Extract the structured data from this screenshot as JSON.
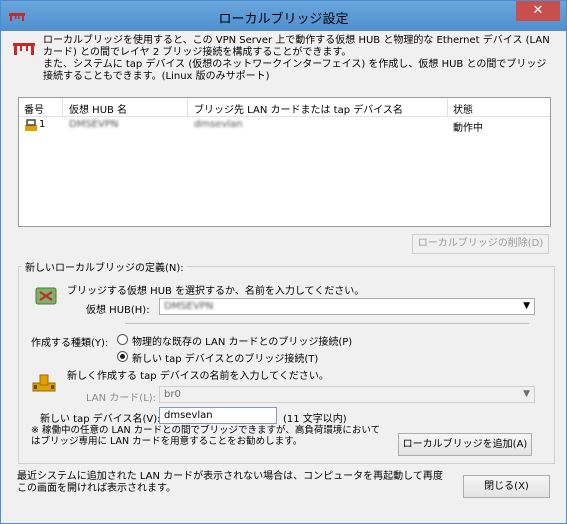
{
  "window": {
    "title": "ローカルブリッジ設定",
    "close_label": "✕"
  },
  "intro": {
    "text": "ローカルブリッジを使用すると、この VPN Server 上で動作する仮想 HUB と物理的な Ethernet デバイス (LAN カード) との間でレイヤ 2 ブリッジ接続を構成することができます。\nまた、システムに tap デバイス (仮想のネットワークインターフェイス) を作成し、仮想 HUB との間でブリッジ接続することもできます。(Linux 版のみサポート)"
  },
  "table": {
    "columns": [
      "番号",
      "仮想 HUB 名",
      "ブリッジ先 LAN カードまたは tap デバイス名",
      "状態"
    ],
    "rows": [
      {
        "number": "1",
        "hub": "DMSEVPN",
        "device": "dmsevlan",
        "status": "動作中"
      }
    ]
  },
  "delete_button": "ローカルブリッジの削除(D)",
  "new_bridge": {
    "group_label": "新しいローカルブリッジの定義(N):",
    "hub_prompt": "ブリッジする仮想 HUB を選択するか、名前を入力してください。",
    "hub_label": "仮想 HUB(H):",
    "hub_value": "DMSEVPN",
    "type_label": "作成する種類(Y):",
    "radio_physical": "物理的な既存の LAN カードとのブリッジ接続(P)",
    "radio_tap": "新しい tap デバイスとのブリッジ接続(T)",
    "radio_selected": "tap",
    "tap_prompt": "新しく作成する tap デバイスの名前を入力してください。",
    "lan_label": "LAN カード(L):",
    "lan_value": "br0",
    "tap_label": "新しい tap デバイス名(V):",
    "tap_value": "dmsevlan",
    "tap_limit": "(11 文字以内)",
    "note": "※ 稼働中の任意の LAN カードとの間でブリッジできますが、高負荷環境においてはブリッジ専用に LAN カードを用意することをお勧めします。",
    "add_button": "ローカルブリッジを追加(A)"
  },
  "footer": {
    "note": "最近システムに追加された LAN カードが表示されない場合は、コンピュータを再起動して再度この画面を開ければ表示されます。",
    "close_button": "閉じる(X)"
  }
}
